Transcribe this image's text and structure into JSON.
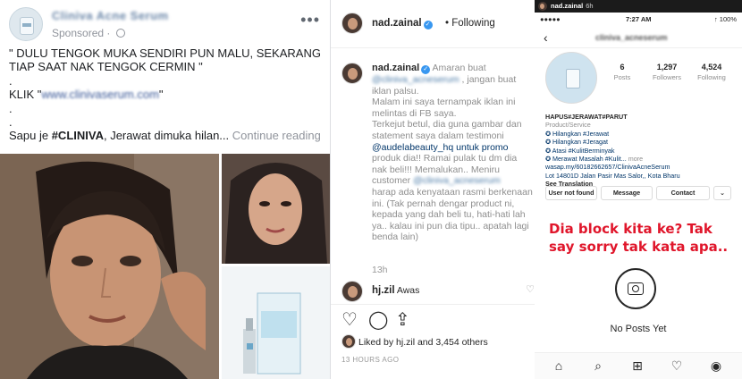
{
  "facebook_post": {
    "page_name": "Cliniva Acne Serum",
    "sponsored_label": "Sponsored",
    "more_label": "•••",
    "lines": [
      "\" DULU TENGOK MUKA SENDIRI PUN MALU, SEKARANG",
      "TIAP SAAT NAK TENGOK CERMIN \"",
      ".",
      ".",
      "."
    ],
    "klik_prefix": "KLIK \"",
    "klik_link": "www.clinivaserum.com",
    "klik_suffix": "\"",
    "last_prefix": "Sapu je ",
    "last_hashtag": "#CLINIVA",
    "last_text": ", Jerawat dimuka hilan...",
    "continue_label": "Continue reading"
  },
  "instagram_post": {
    "username": "nad.zainal",
    "follow_state": "Following",
    "caption_user": "nad.zainal",
    "caption": [
      "Amaran buat",
      " , jangan buat",
      "iklan palsu.",
      "Malam ini saya ternampak iklan ini",
      "melintas di FB saya.",
      "Terkejut betul, dia guna gambar dan",
      "statement saya dalam testimoni",
      "@audelabeauty_hq untuk promo",
      "produk dia!! Ramai pulak tu dm dia",
      "nak beli!!! Memalukan.. Meniru",
      "customer",
      "harap ada kenyataan rasmi berkenaan",
      "ini. (Tak pernah dengar product ni,",
      "kepada yang dah beli tu, hati-hati lah",
      "ya.. kalau ini pun dia tipu.. apatah lagi",
      "benda lain)"
    ],
    "blurred_account": "@cliniva_acneserum",
    "caption_time": "13h",
    "comment_user": "hj.zil",
    "comment_text": "Awas",
    "likes_text": "Liked by hj.zil and 3,454 others",
    "post_date": "13 HOURS AGO"
  },
  "story": {
    "poster": "nad.zainal",
    "poster_age": "6h",
    "status_carrier": "●●●●● ",
    "status_time": "7:27 AM",
    "status_battery": "↑ 100%",
    "profile_title": "cliniva_acneserum",
    "posts_count": "6",
    "posts_label": "Posts",
    "followers_count": "1,297",
    "followers_label": "Followers",
    "following_count": "4,524",
    "following_label": "Following",
    "bio_name": "HAPUS#JERAWAT#PARUT",
    "bio_category": "Product/Service",
    "bio_lines": [
      "✪ Hilangkan #Jerawat",
      "✪ Hilangkan #Jeragat",
      "✪ Atasi #KulitBerminyak",
      "✪ Merawat Masalah #Kulit..."
    ],
    "bio_more": "more",
    "bio_link": "wasap.my/60182662657/ClinivaAcneSerum",
    "bio_address": "Lot 14801D Jalan Pasir Mas Salor,, Kota Bharu",
    "see_translation": "See Translation",
    "btn_user_not_found": "User not found",
    "btn_message": "Message",
    "btn_contact": "Contact",
    "caption_overlay": "Dia block kita ke? Tak say sorry tak kata apa..",
    "empty_state": "No Posts Yet"
  },
  "colors": {
    "fb_link": "#385898",
    "ig_verified": "#3897f0",
    "story_caption": "#e0162b"
  }
}
